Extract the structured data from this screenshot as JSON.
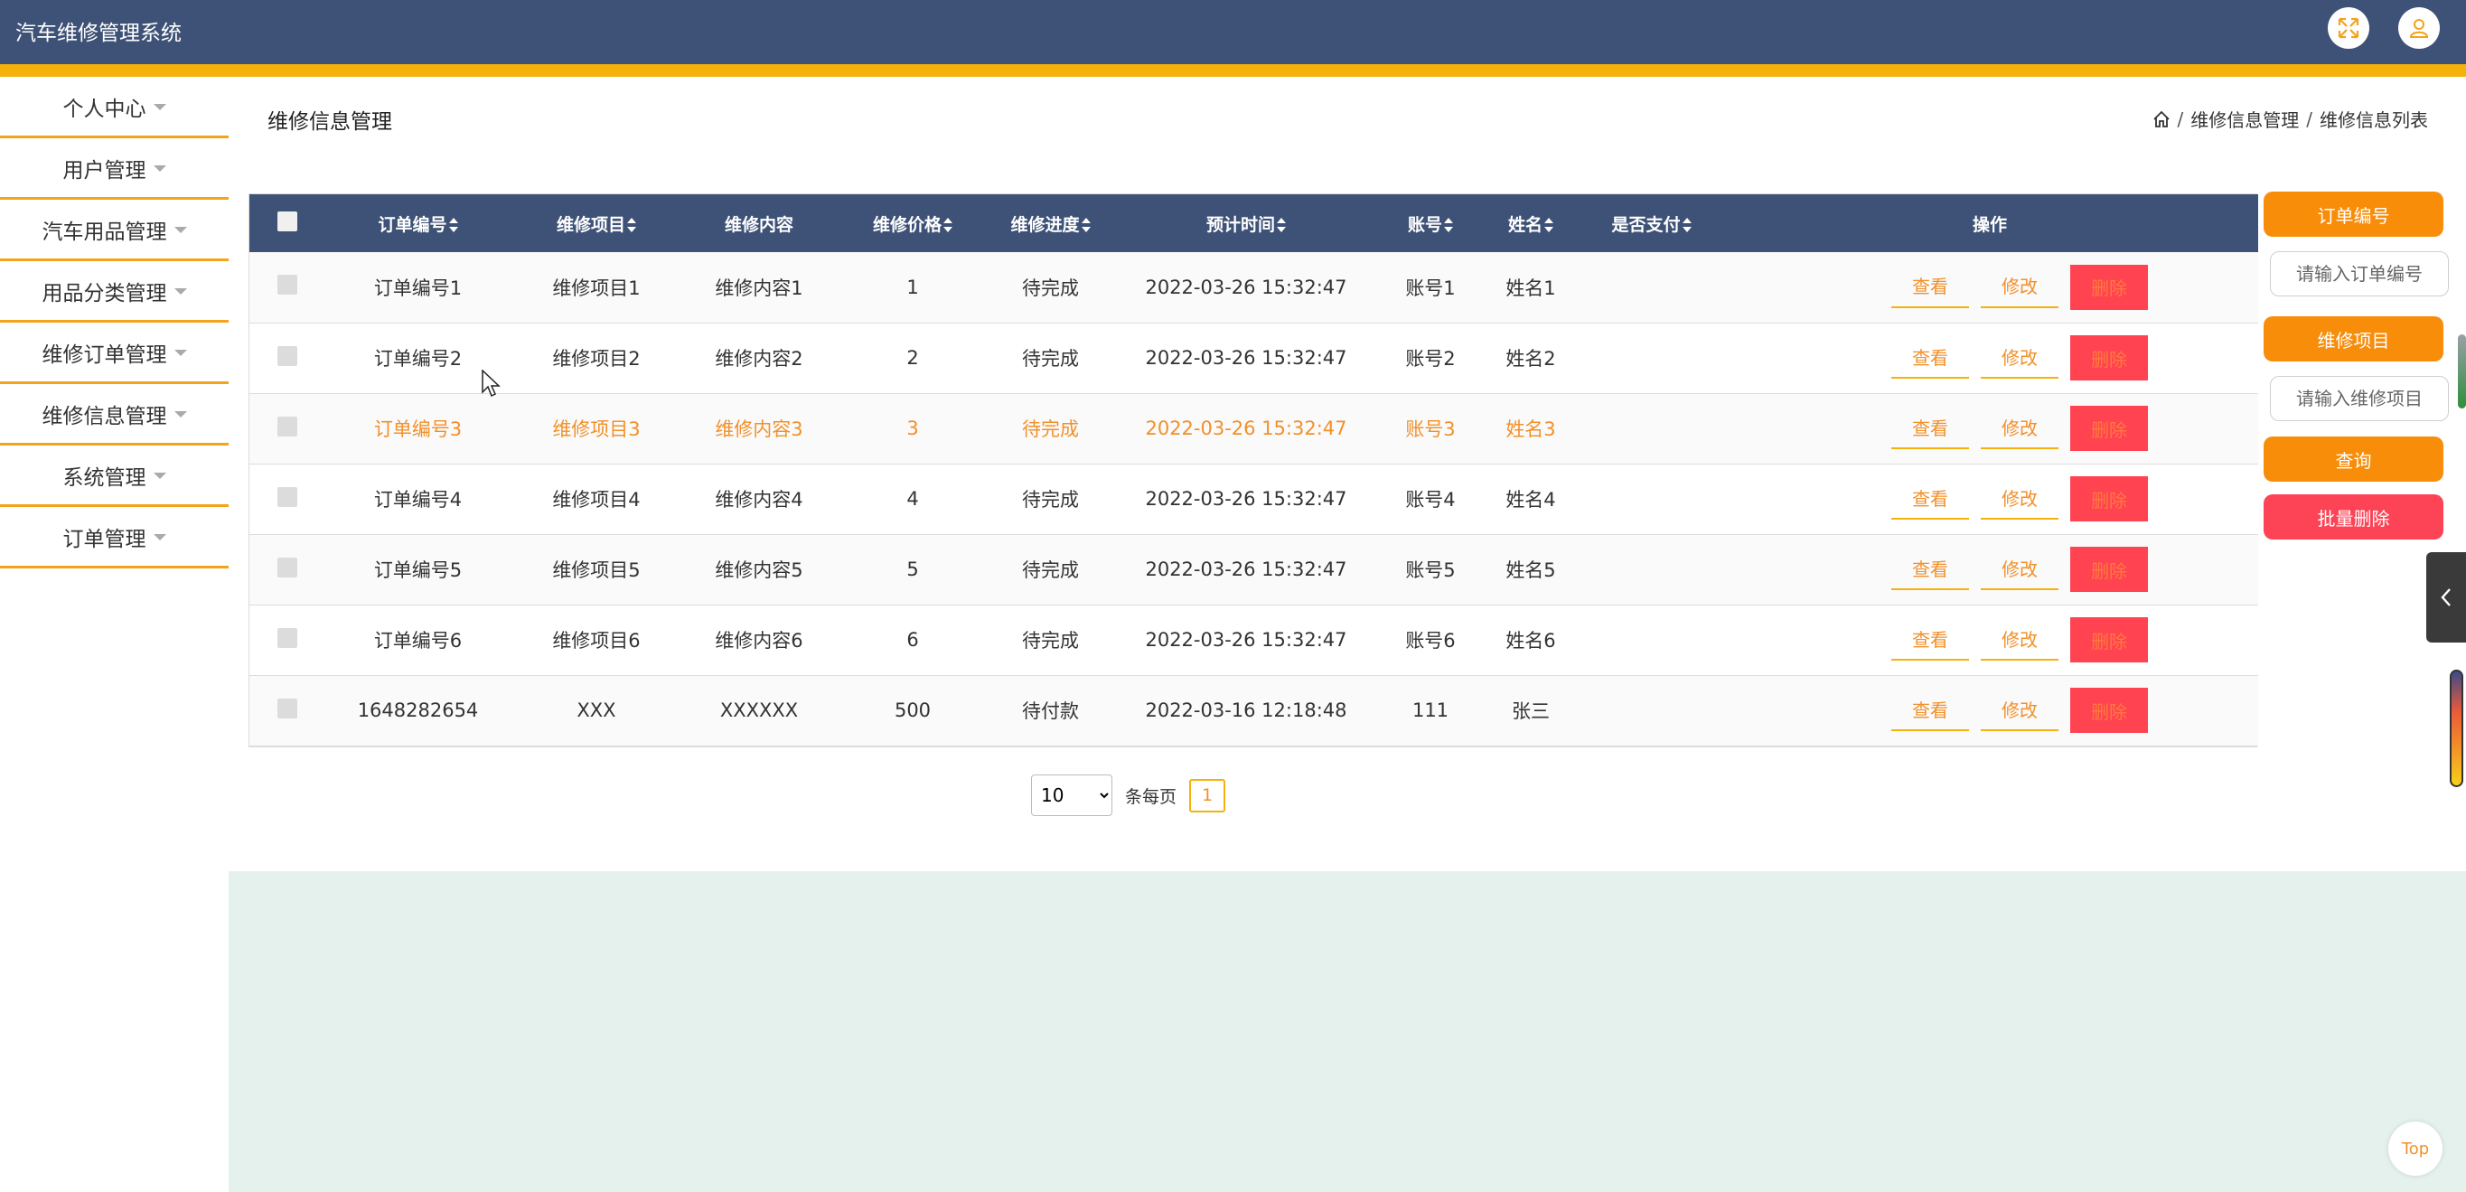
{
  "app": {
    "title": "汽车维修管理系统"
  },
  "header": {
    "fullscreen_icon": "fullscreen-icon",
    "user_icon": "user-icon",
    "accent_color": "#f4b20b",
    "bar_color": "#3e5277"
  },
  "sidebar": {
    "items": [
      {
        "label": "个人中心"
      },
      {
        "label": "用户管理"
      },
      {
        "label": "汽车用品管理"
      },
      {
        "label": "用品分类管理"
      },
      {
        "label": "维修订单管理"
      },
      {
        "label": "维修信息管理"
      },
      {
        "label": "系统管理"
      },
      {
        "label": "订单管理"
      }
    ]
  },
  "page": {
    "title": "维修信息管理",
    "breadcrumb": {
      "level1": "维修信息管理",
      "level2": "维修信息列表",
      "separator": "/"
    }
  },
  "table": {
    "columns": {
      "order_no": "订单编号",
      "item": "维修项目",
      "content": "维修内容",
      "price": "维修价格",
      "progress": "维修进度",
      "time": "预计时间",
      "account": "账号",
      "name": "姓名",
      "paid": "是否支付",
      "ops": "操作"
    },
    "rows": [
      {
        "order_no": "订单编号1",
        "item": "维修项目1",
        "content": "维修内容1",
        "price": "1",
        "progress": "待完成",
        "time": "2022-03-26 15:32:47",
        "account": "账号1",
        "name": "姓名1",
        "paid": ""
      },
      {
        "order_no": "订单编号2",
        "item": "维修项目2",
        "content": "维修内容2",
        "price": "2",
        "progress": "待完成",
        "time": "2022-03-26 15:32:47",
        "account": "账号2",
        "name": "姓名2",
        "paid": ""
      },
      {
        "order_no": "订单编号3",
        "item": "维修项目3",
        "content": "维修内容3",
        "price": "3",
        "progress": "待完成",
        "time": "2022-03-26 15:32:47",
        "account": "账号3",
        "name": "姓名3",
        "paid": ""
      },
      {
        "order_no": "订单编号4",
        "item": "维修项目4",
        "content": "维修内容4",
        "price": "4",
        "progress": "待完成",
        "time": "2022-03-26 15:32:47",
        "account": "账号4",
        "name": "姓名4",
        "paid": ""
      },
      {
        "order_no": "订单编号5",
        "item": "维修项目5",
        "content": "维修内容5",
        "price": "5",
        "progress": "待完成",
        "time": "2022-03-26 15:32:47",
        "account": "账号5",
        "name": "姓名5",
        "paid": ""
      },
      {
        "order_no": "订单编号6",
        "item": "维修项目6",
        "content": "维修内容6",
        "price": "6",
        "progress": "待完成",
        "time": "2022-03-26 15:32:47",
        "account": "账号6",
        "name": "姓名6",
        "paid": ""
      },
      {
        "order_no": "1648282654",
        "item": "XXX",
        "content": "XXXXXX",
        "price": "500",
        "progress": "待付款",
        "time": "2022-03-16 12:18:48",
        "account": "111",
        "name": "张三",
        "paid": ""
      }
    ],
    "actions": {
      "view": "查看",
      "edit": "修改",
      "delete": "删除"
    },
    "highlight_color": "#f2902a"
  },
  "pagination": {
    "page_size": "10",
    "page_size_options": [
      "10"
    ],
    "per_page_label": "条每页",
    "current_page": "1"
  },
  "search": {
    "order_no_label": "订单编号",
    "order_no_placeholder": "请输入订单编号",
    "item_label": "维修项目",
    "item_placeholder": "请输入维修项目",
    "query_button": "查询",
    "batch_delete_button": "批量删除"
  },
  "widgets": {
    "back_to_top": "Top",
    "collapse_icon": "chevron-left-icon"
  }
}
